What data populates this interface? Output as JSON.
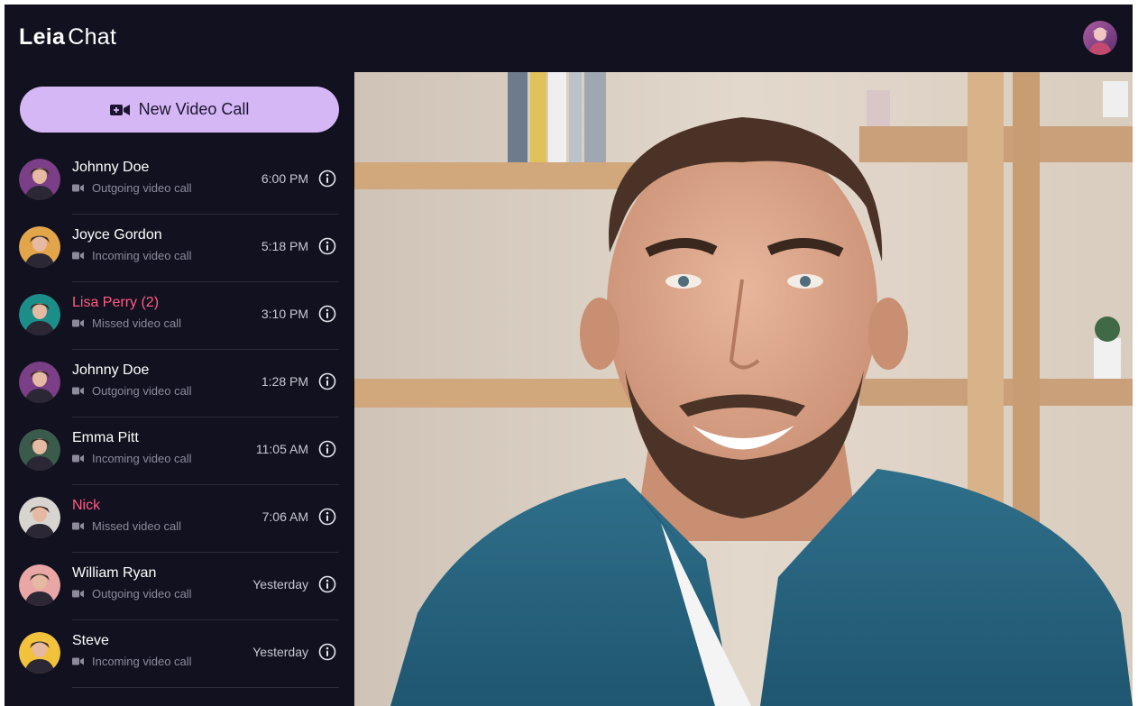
{
  "app": {
    "logo_bold": "Leia",
    "logo_light": "Chat"
  },
  "sidebar": {
    "new_call_label": "New Video Call",
    "calls": [
      {
        "name": "Johnny Doe",
        "type": "Outgoing video call",
        "time": "6:00 PM",
        "missed": false,
        "avatar_color": "#7a3f86"
      },
      {
        "name": "Joyce Gordon",
        "type": "Incoming video call",
        "time": "5:18 PM",
        "missed": false,
        "avatar_color": "#e3a54a"
      },
      {
        "name": "Lisa Perry (2)",
        "type": "Missed video call",
        "time": "3:10 PM",
        "missed": true,
        "avatar_color": "#1c8e8a"
      },
      {
        "name": "Johnny Doe",
        "type": "Outgoing video call",
        "time": "1:28 PM",
        "missed": false,
        "avatar_color": "#7a3f86"
      },
      {
        "name": "Emma Pitt",
        "type": "Incoming video call",
        "time": "11:05 AM",
        "missed": false,
        "avatar_color": "#3a5a4c"
      },
      {
        "name": "Nick",
        "type": "Missed video call",
        "time": "7:06 AM",
        "missed": true,
        "avatar_color": "#d8d4cf"
      },
      {
        "name": "William Ryan",
        "type": "Outgoing video call",
        "time": "Yesterday",
        "missed": false,
        "avatar_color": "#e9a6a6"
      },
      {
        "name": "Steve",
        "type": "Incoming video call",
        "time": "Yesterday",
        "missed": false,
        "avatar_color": "#f2c23d"
      }
    ]
  },
  "colors": {
    "background": "#12111f",
    "accent": "#d6b7f5",
    "missed": "#ff5c84",
    "muted_text": "#8d8a9c"
  },
  "icons": {
    "new_call": "video-camera-icon",
    "call_type": "video-camera-icon",
    "details": "info-icon"
  }
}
